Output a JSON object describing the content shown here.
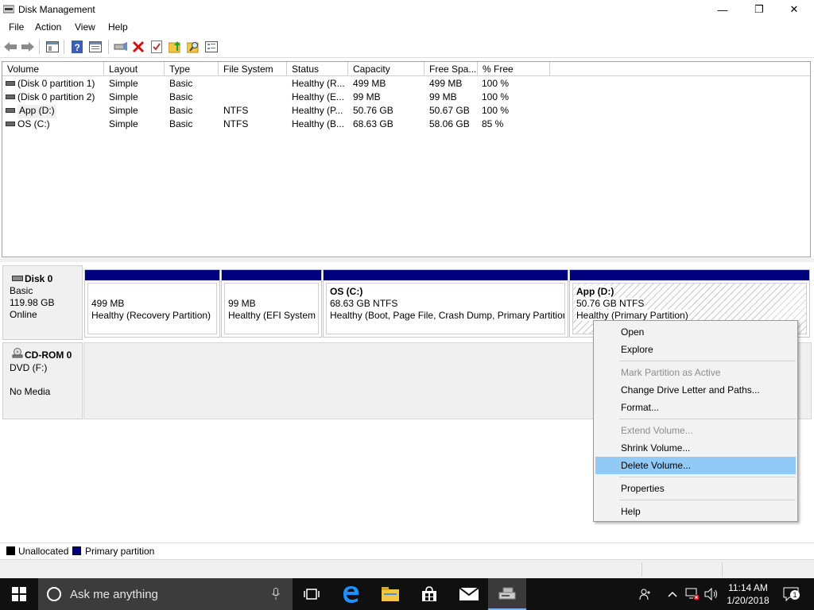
{
  "window": {
    "title": "Disk Management",
    "controls": {
      "minimize": "—",
      "maximize": "❐",
      "close": "✕"
    }
  },
  "menu": {
    "items": [
      "File",
      "Action",
      "View",
      "Help"
    ]
  },
  "toolbar": {
    "icons": [
      "back-arrow-icon",
      "forward-arrow-icon",
      "show-hide-console-tree-icon",
      "help-icon",
      "properties-icon",
      "connect-drive-icon",
      "delete-icon",
      "check-icon",
      "up-folder-icon",
      "search-folder-icon",
      "list-view-icon"
    ]
  },
  "volume_list": {
    "columns": [
      "Volume",
      "Layout",
      "Type",
      "File System",
      "Status",
      "Capacity",
      "Free Spa...",
      "% Free"
    ],
    "rows": [
      {
        "volume": "(Disk 0 partition 1)",
        "layout": "Simple",
        "type": "Basic",
        "fs": "",
        "status": "Healthy (R...",
        "capacity": "499 MB",
        "free": "499 MB",
        "pct": "100 %"
      },
      {
        "volume": "(Disk 0 partition 2)",
        "layout": "Simple",
        "type": "Basic",
        "fs": "",
        "status": "Healthy (E...",
        "capacity": "99 MB",
        "free": "99 MB",
        "pct": "100 %"
      },
      {
        "volume": "App (D:)",
        "layout": "Simple",
        "type": "Basic",
        "fs": "NTFS",
        "status": "Healthy (P...",
        "capacity": "50.76 GB",
        "free": "50.67 GB",
        "pct": "100 %"
      },
      {
        "volume": "OS (C:)",
        "layout": "Simple",
        "type": "Basic",
        "fs": "NTFS",
        "status": "Healthy (B...",
        "capacity": "68.63 GB",
        "free": "58.06 GB",
        "pct": "85 %"
      }
    ]
  },
  "disks": [
    {
      "name": "Disk 0",
      "type": "Basic",
      "size": "119.98 GB",
      "state": "Online",
      "partitions": [
        {
          "name": "",
          "size": "499 MB",
          "status": "Healthy (Recovery Partition)"
        },
        {
          "name": "",
          "size": "99 MB",
          "status": "Healthy (EFI System P"
        },
        {
          "name": "OS  (C:)",
          "size": "68.63 GB NTFS",
          "status": "Healthy (Boot, Page File, Crash Dump, Primary Partition)"
        },
        {
          "name": "App  (D:)",
          "size": "50.76 GB NTFS",
          "status": "Healthy (Primary Partition)"
        }
      ]
    },
    {
      "name": "CD-ROM 0",
      "type": "DVD (F:)",
      "size": "",
      "state": "No Media"
    }
  ],
  "legend": [
    {
      "label": "Unallocated",
      "color": "#000000"
    },
    {
      "label": "Primary partition",
      "color": "#00007f"
    }
  ],
  "context_menu": {
    "items": [
      {
        "label": "Open",
        "enabled": true
      },
      {
        "label": "Explore",
        "enabled": true
      },
      {
        "label": "Mark Partition as Active",
        "enabled": false
      },
      {
        "label": "Change Drive Letter and Paths...",
        "enabled": true
      },
      {
        "label": "Format...",
        "enabled": true
      },
      {
        "label": "Extend Volume...",
        "enabled": false
      },
      {
        "label": "Shrink Volume...",
        "enabled": true
      },
      {
        "label": "Delete Volume...",
        "enabled": true,
        "highlighted": true
      },
      {
        "label": "Properties",
        "enabled": true
      },
      {
        "label": "Help",
        "enabled": true
      }
    ]
  },
  "taskbar": {
    "search_placeholder": "Ask me anything",
    "time": "11:14 AM",
    "date": "1/20/2018",
    "notification_count": "1",
    "apps": [
      "task-view-icon",
      "edge-icon",
      "file-explorer-icon",
      "store-icon",
      "mail-icon",
      "disk-management-icon"
    ]
  },
  "colors": {
    "primary_partition": "#00007f",
    "menu_highlight": "#91c9f7",
    "taskbar": "#101010"
  }
}
